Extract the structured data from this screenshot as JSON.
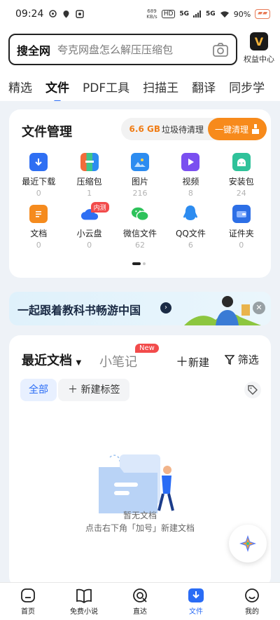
{
  "status": {
    "time": "09:24",
    "battery": "90%",
    "speed_top": "689",
    "speed_bottom": "KB/s",
    "network1": "HD",
    "signal1": "5G",
    "signal2": "5G"
  },
  "header": {
    "brand": "搜全网",
    "placeholder": "夸克网盘怎么解压压缩包",
    "perks_label": "权益中心",
    "perks_icon": "V"
  },
  "tabs": [
    {
      "label": "精选"
    },
    {
      "label": "文件"
    },
    {
      "label": "PDF工具"
    },
    {
      "label": "扫描王"
    },
    {
      "label": "翻译"
    },
    {
      "label": "同步学"
    }
  ],
  "file_manager": {
    "title": "文件管理",
    "junk_size": "6.6 GB",
    "junk_text": "垃圾待清理",
    "clean_button": "一键清理",
    "items": [
      {
        "label": "最近下载",
        "count": "0",
        "icon": "download-icon",
        "color": "#2f6ff3"
      },
      {
        "label": "压缩包",
        "count": "1",
        "icon": "archive-icon",
        "color": "#3ec58a"
      },
      {
        "label": "图片",
        "count": "216",
        "icon": "image-icon",
        "color": "#2d8cf0"
      },
      {
        "label": "视频",
        "count": "8",
        "icon": "video-icon",
        "color": "#7a4ff0"
      },
      {
        "label": "安装包",
        "count": "24",
        "icon": "android-icon",
        "color": "#2fc29a"
      },
      {
        "label": "文档",
        "count": "0",
        "icon": "document-icon",
        "color": "#f58b1e"
      },
      {
        "label": "小云盘",
        "count": "0",
        "icon": "cloud-icon",
        "color": "#2f6ff3",
        "badge": "内测"
      },
      {
        "label": "微信文件",
        "count": "62",
        "icon": "wechat-icon",
        "color": "#2dc25a"
      },
      {
        "label": "QQ文件",
        "count": "6",
        "icon": "qq-icon",
        "color": "#2d8cf0"
      },
      {
        "label": "证件夹",
        "count": "0",
        "icon": "id-folder-icon",
        "color": "#2d6fe6"
      }
    ]
  },
  "banner": {
    "text": "一起跟着教科书畅游中国",
    "arrow": "›",
    "close": "✕"
  },
  "docs": {
    "recent_label": "最近文档",
    "notes_label": "小笔记",
    "new_badge": "New",
    "new_doc_label": "新建",
    "filter_label": "筛选",
    "chip_all": "全部",
    "chip_new_tag": "新建标签",
    "empty_title": "暂无文档",
    "empty_hint": "点击右下角「加号」新建文档"
  },
  "bottom_nav": [
    {
      "label": "首页",
      "icon": "home-icon"
    },
    {
      "label": "免费小说",
      "icon": "book-icon"
    },
    {
      "label": "直达",
      "icon": "direct-icon"
    },
    {
      "label": "文件",
      "icon": "file-download-icon"
    },
    {
      "label": "我的",
      "icon": "profile-icon"
    }
  ],
  "colors": {
    "accent": "#2a6cf5",
    "orange": "#f78a1b",
    "badge_red": "#f24b4b"
  }
}
